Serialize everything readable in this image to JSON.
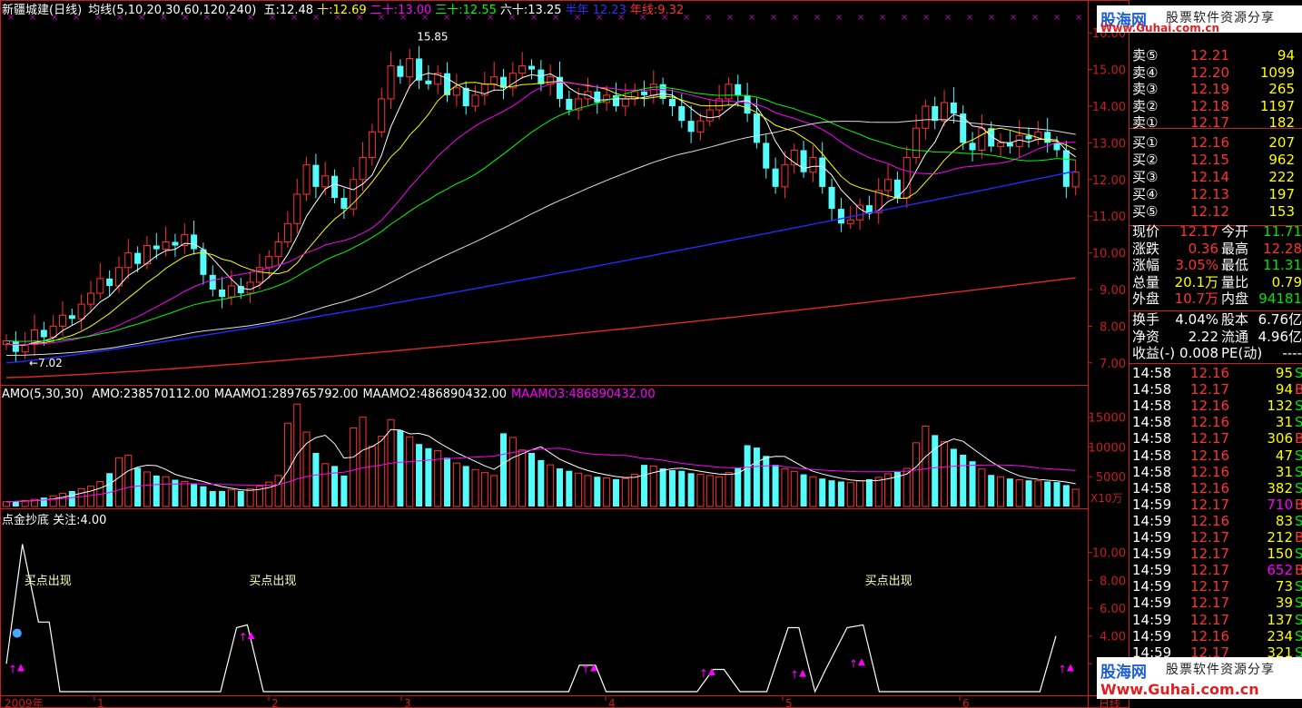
{
  "header": {
    "stock": "新疆城建(日线)",
    "ma_title": "均线(5,10,20,30,60,120,240)",
    "ma_items": [
      {
        "label": "五:12.48",
        "color": "#ffffff"
      },
      {
        "label": "十:12.69",
        "color": "#ffff00"
      },
      {
        "label": "二十:13.00",
        "color": "#ff00ff"
      },
      {
        "label": "三十:12.55",
        "color": "#00ff00"
      },
      {
        "label": "六十:13.25",
        "color": "#ffffff"
      },
      {
        "label": "半年 12.23",
        "color": "#3030ff"
      },
      {
        "label": "年线:9.32",
        "color": "#ff3232"
      }
    ]
  },
  "vol_header": {
    "prefix": "AMO(5,30,30)",
    "items": [
      {
        "label": "AMO:238570112.00",
        "color": "#ffffff"
      },
      {
        "label": "MAAMO1:289765792.00",
        "color": "#ffffff"
      },
      {
        "label": "MAAMO2:486890432.00",
        "color": "#ffffff"
      },
      {
        "label": "MAAMO3:486890432.00",
        "color": "#ff00ff"
      }
    ]
  },
  "ind_header": "点金抄底 关注:4.00",
  "price_labels": {
    "high": "15.85",
    "low": "7.02"
  },
  "buy_signal_text": "买点出现",
  "x_axis": [
    "2009年",
    "1",
    "2",
    "3",
    "4",
    "5",
    "6",
    "日线"
  ],
  "vol_unit": "X10万",
  "order_book": {
    "sells": [
      {
        "label": "卖⑤",
        "price": "12.21",
        "volume": "94"
      },
      {
        "label": "卖④",
        "price": "12.20",
        "volume": "1099"
      },
      {
        "label": "卖③",
        "price": "12.19",
        "volume": "265"
      },
      {
        "label": "卖②",
        "price": "12.18",
        "volume": "1197"
      },
      {
        "label": "卖①",
        "price": "12.17",
        "volume": "182"
      }
    ],
    "buys": [
      {
        "label": "买①",
        "price": "12.16",
        "volume": "207"
      },
      {
        "label": "买②",
        "price": "12.15",
        "volume": "962"
      },
      {
        "label": "买③",
        "price": "12.14",
        "volume": "222"
      },
      {
        "label": "买④",
        "price": "12.13",
        "volume": "197"
      },
      {
        "label": "买⑤",
        "price": "12.12",
        "volume": "153"
      }
    ]
  },
  "quote": [
    {
      "l1": "现价",
      "v1": "12.17",
      "c1": "#ff3232",
      "l2": "今开",
      "v2": "11.71",
      "c2": "#00e600"
    },
    {
      "l1": "涨跌",
      "v1": "0.36",
      "c1": "#ff3232",
      "l2": "最高",
      "v2": "12.28",
      "c2": "#ff3232"
    },
    {
      "l1": "涨幅",
      "v1": "3.05%",
      "c1": "#ff3232",
      "l2": "最低",
      "v2": "11.31",
      "c2": "#00e600"
    },
    {
      "l1": "总量",
      "v1": "20.1万",
      "c1": "#ffff00",
      "l2": "量比",
      "v2": "0.79",
      "c2": "#ffff00"
    },
    {
      "l1": "外盘",
      "v1": "10.7万",
      "c1": "#ff3232",
      "l2": "内盘",
      "v2": "94181",
      "c2": "#00e600"
    },
    {
      "l1": "换手",
      "v1": "4.04%",
      "c1": "#ffffff",
      "l2": "股本",
      "v2": "6.76亿",
      "c2": "#ffffff"
    },
    {
      "l1": "净资",
      "v1": "2.22",
      "c1": "#ffffff",
      "l2": "流通",
      "v2": "4.96亿",
      "c2": "#ffffff"
    },
    {
      "l1": "收益(-)",
      "v1": "0.008",
      "c1": "#ffffff",
      "l2": "PE(动)",
      "v2": "----",
      "c2": "#ffffff"
    }
  ],
  "ticks": [
    {
      "t": "14:58",
      "p": "12.16",
      "pc": "#ff3232",
      "v": "95",
      "vc": "#ffff00",
      "f": "S",
      "fc": "#00e600"
    },
    {
      "t": "14:58",
      "p": "12.17",
      "pc": "#ff3232",
      "v": "94",
      "vc": "#ffff00",
      "f": "B",
      "fc": "#ff3232"
    },
    {
      "t": "14:58",
      "p": "12.16",
      "pc": "#ff3232",
      "v": "132",
      "vc": "#ffff00",
      "f": "S",
      "fc": "#00e600"
    },
    {
      "t": "14:58",
      "p": "12.16",
      "pc": "#ff3232",
      "v": "31",
      "vc": "#ffff00",
      "f": "S",
      "fc": "#00e600"
    },
    {
      "t": "14:58",
      "p": "12.17",
      "pc": "#ff3232",
      "v": "306",
      "vc": "#ffff00",
      "f": "B",
      "fc": "#ff3232"
    },
    {
      "t": "14:58",
      "p": "12.16",
      "pc": "#ff3232",
      "v": "47",
      "vc": "#ffff00",
      "f": "S",
      "fc": "#00e600"
    },
    {
      "t": "14:58",
      "p": "12.16",
      "pc": "#ff3232",
      "v": "31",
      "vc": "#ffff00",
      "f": "S",
      "fc": "#00e600"
    },
    {
      "t": "14:58",
      "p": "12.16",
      "pc": "#ff3232",
      "v": "382",
      "vc": "#ffff00",
      "f": "S",
      "fc": "#00e600"
    },
    {
      "t": "14:59",
      "p": "12.17",
      "pc": "#ff3232",
      "v": "710",
      "vc": "#ff00ff",
      "f": "B",
      "fc": "#ff3232"
    },
    {
      "t": "14:59",
      "p": "12.16",
      "pc": "#ff3232",
      "v": "83",
      "vc": "#ffff00",
      "f": "S",
      "fc": "#00e600"
    },
    {
      "t": "14:59",
      "p": "12.17",
      "pc": "#ff3232",
      "v": "212",
      "vc": "#ffff00",
      "f": "B",
      "fc": "#ff3232"
    },
    {
      "t": "14:59",
      "p": "12.17",
      "pc": "#ff3232",
      "v": "150",
      "vc": "#ffff00",
      "f": "S",
      "fc": "#00e600"
    },
    {
      "t": "14:59",
      "p": "12.17",
      "pc": "#ff3232",
      "v": "652",
      "vc": "#ff00ff",
      "f": "B",
      "fc": "#ff3232"
    },
    {
      "t": "14:59",
      "p": "12.17",
      "pc": "#ff3232",
      "v": "73",
      "vc": "#ffff00",
      "f": "S",
      "fc": "#00e600"
    },
    {
      "t": "14:59",
      "p": "12.17",
      "pc": "#ff3232",
      "v": "39",
      "vc": "#ffff00",
      "f": "S",
      "fc": "#00e600"
    },
    {
      "t": "14:59",
      "p": "12.17",
      "pc": "#ff3232",
      "v": "137",
      "vc": "#ffff00",
      "f": "S",
      "fc": "#00e600"
    },
    {
      "t": "14:59",
      "p": "12.16",
      "pc": "#ff3232",
      "v": "234",
      "vc": "#ffff00",
      "f": "S",
      "fc": "#00e600"
    },
    {
      "t": "14:59",
      "p": "12.17",
      "pc": "#ff3232",
      "v": "321",
      "vc": "#ffff00",
      "f": "S",
      "fc": "#00e600"
    }
  ],
  "watermark": {
    "brand": "股海网",
    "slogan": "股票软件资源分享",
    "url": "Www.Guhai.com.cn"
  },
  "chart_data": [
    {
      "type": "candlestick",
      "title": "新疆城建(日线)",
      "ylim": [
        6.5,
        16.5
      ],
      "yticks": [
        "7.00",
        "8.00",
        "9.00",
        "10.00",
        "11.00",
        "12.00",
        "13.00",
        "14.00",
        "15.00",
        "16.00"
      ],
      "closes": [
        7.6,
        7.3,
        7.5,
        7.9,
        7.7,
        8.0,
        8.3,
        8.2,
        8.6,
        8.9,
        9.3,
        9.1,
        9.6,
        10.0,
        9.7,
        10.2,
        10.1,
        10.3,
        10.2,
        10.5,
        10.1,
        9.4,
        9.0,
        8.8,
        9.1,
        8.9,
        9.2,
        9.6,
        9.9,
        10.3,
        10.8,
        11.6,
        12.4,
        11.8,
        12.1,
        11.5,
        11.2,
        12.0,
        12.6,
        13.3,
        14.2,
        15.1,
        14.8,
        15.3,
        14.7,
        14.6,
        14.9,
        14.3,
        14.5,
        14.0,
        14.3,
        14.6,
        14.8,
        14.5,
        14.9,
        15.1,
        15.0,
        14.6,
        14.8,
        14.2,
        13.9,
        14.2,
        14.4,
        14.1,
        14.3,
        14.0,
        14.2,
        14.4,
        14.3,
        14.6,
        14.2,
        14.0,
        13.6,
        13.3,
        13.6,
        13.9,
        14.2,
        14.6,
        14.3,
        13.8,
        13.0,
        12.3,
        11.8,
        12.4,
        12.8,
        12.2,
        12.6,
        11.8,
        11.2,
        10.8,
        10.9,
        11.3,
        11.1,
        11.7,
        12.0,
        11.5,
        12.6,
        13.4,
        14.0,
        13.6,
        14.1,
        13.8,
        13.0,
        12.8,
        13.4,
        12.9,
        13.0,
        12.9,
        13.2,
        13.1,
        13.3,
        13.0,
        12.8,
        11.8,
        12.2
      ],
      "ma_high_value": 15.85,
      "ma_low_value": 7.02,
      "ma_series": [
        {
          "name": "五",
          "value": 12.48
        },
        {
          "name": "十",
          "value": 12.69
        },
        {
          "name": "二十",
          "value": 13.0
        },
        {
          "name": "三十",
          "value": 12.55
        },
        {
          "name": "六十",
          "value": 13.25
        },
        {
          "name": "半年",
          "value": 12.23
        },
        {
          "name": "年线",
          "value": 9.32
        }
      ]
    },
    {
      "type": "bar",
      "title": "AMO(5,30,30)",
      "unit": "X10万",
      "ylim": [
        0,
        18000
      ],
      "yticks": [
        "5000",
        "10000",
        "15000"
      ],
      "values": [
        800,
        900,
        1000,
        1200,
        1500,
        1800,
        2200,
        2600,
        3000,
        3400,
        4200,
        5600,
        8200,
        8600,
        6500,
        5800,
        5200,
        5000,
        4500,
        4200,
        3900,
        3400,
        2600,
        2600,
        2800,
        2600,
        3000,
        3400,
        4100,
        5200,
        14000,
        17200,
        12500,
        9000,
        7200,
        6800,
        5200,
        13200,
        15000,
        10100,
        11800,
        14600,
        12800,
        11700,
        10500,
        9800,
        9400,
        8200,
        7300,
        6800,
        6200,
        5700,
        5200,
        12300,
        11600,
        9500,
        9000,
        7800,
        7000,
        6400,
        6000,
        5600,
        5200,
        5000,
        4800,
        4600,
        4700,
        5400,
        7000,
        6800,
        6400,
        6100,
        6000,
        5600,
        5400,
        5200,
        5000,
        5700,
        6500,
        10300,
        9900,
        8500,
        7000,
        6300,
        5900,
        5400,
        5000,
        4700,
        4400,
        4200,
        4000,
        4300,
        4600,
        4900,
        5500,
        5800,
        6400,
        10700,
        13500,
        12000,
        10900,
        9700,
        8700,
        7600,
        6300,
        5300,
        5000,
        4700,
        4500,
        4400,
        4300,
        4200,
        4100,
        3600,
        2900
      ],
      "ma_values": [
        {
          "name": "MAAMO1",
          "value": 289765792.0
        },
        {
          "name": "MAAMO2",
          "value": 486890432.0
        },
        {
          "name": "MAAMO3",
          "value": 486890432.0
        }
      ]
    },
    {
      "type": "line",
      "title": "点金抄底",
      "focus_level": 4.0,
      "ylim": [
        0,
        12
      ],
      "yticks": [
        "2.00",
        "4.00",
        "6.00",
        "8.00",
        "10.00"
      ],
      "points": [
        [
          0,
          2.0
        ],
        [
          3,
          10.6
        ],
        [
          6,
          5.0
        ],
        [
          8,
          5.0
        ],
        [
          10,
          0
        ],
        [
          40,
          0
        ],
        [
          43,
          4.6
        ],
        [
          45,
          4.8
        ],
        [
          48,
          0
        ],
        [
          105,
          0
        ],
        [
          107,
          1.9
        ],
        [
          110,
          1.9
        ],
        [
          112,
          0
        ],
        [
          129,
          0
        ],
        [
          132,
          1.6
        ],
        [
          134,
          1.6
        ],
        [
          137,
          0
        ],
        [
          142,
          0
        ],
        [
          146,
          4.6
        ],
        [
          148,
          4.6
        ],
        [
          151,
          0
        ],
        [
          153,
          1.6
        ],
        [
          157,
          4.6
        ],
        [
          160,
          4.8
        ],
        [
          163,
          0
        ],
        [
          193,
          0
        ],
        [
          196,
          4.0
        ]
      ],
      "signals": [
        {
          "x": 3,
          "label": "买点出现"
        },
        {
          "x": 45,
          "label": "买点出现"
        },
        {
          "x": 160,
          "label": "买点出现"
        }
      ]
    }
  ]
}
